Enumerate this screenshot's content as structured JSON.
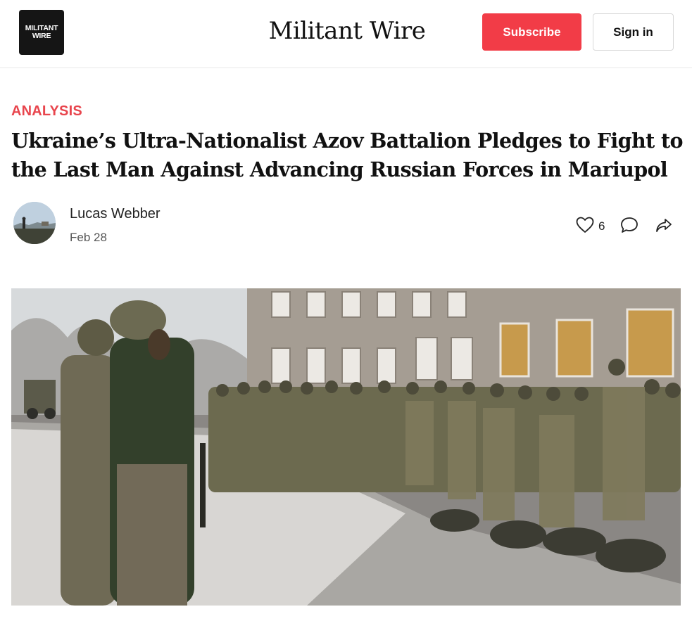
{
  "header": {
    "logo_line1": "MILITANT",
    "logo_line2": "WIRE",
    "site_title": "Militant Wire",
    "subscribe_label": "Subscribe",
    "signin_label": "Sign in"
  },
  "article": {
    "category": "ANALYSIS",
    "title": "Ukraine’s Ultra-Nationalist Azov Battalion Pledges to Fight to the Last Man Against Advancing Russian Forces in Mariupol",
    "author": "Lucas Webber",
    "date": "Feb 28",
    "like_count": "6"
  },
  "icons": {
    "like": "heart-icon",
    "comment": "comment-icon",
    "share": "share-icon"
  },
  "colors": {
    "accent": "#f23c47",
    "category": "#e8454d"
  }
}
